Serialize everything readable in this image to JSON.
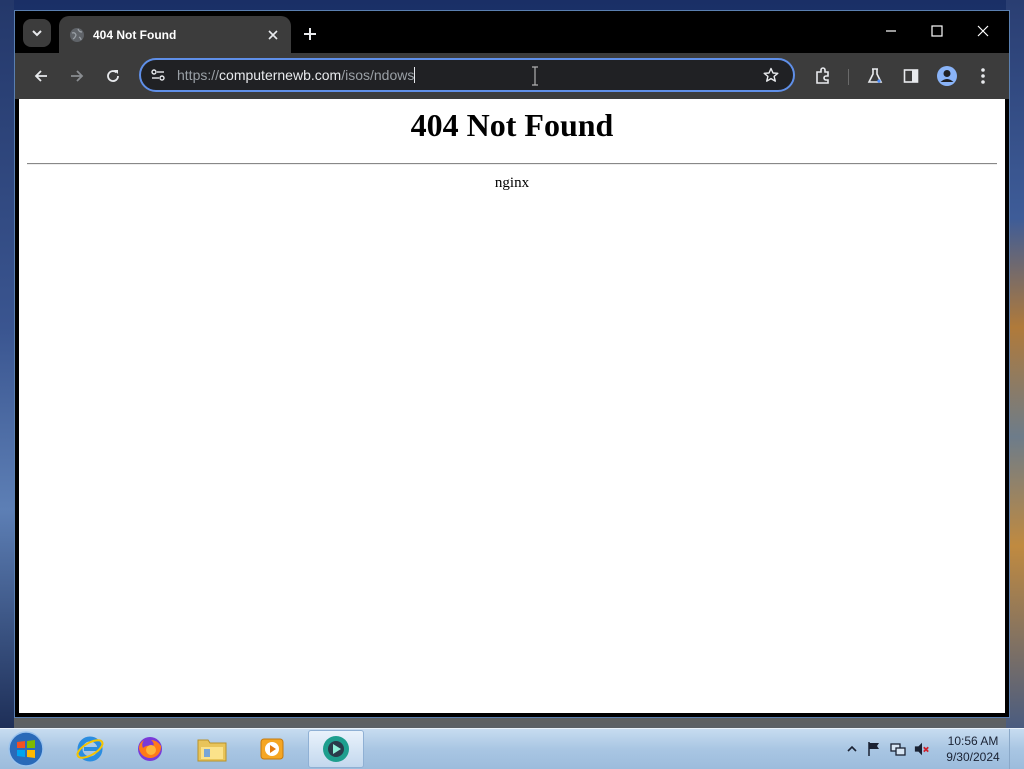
{
  "browser": {
    "tab": {
      "title": "404 Not Found"
    },
    "address_bar": {
      "url_scheme": "https://",
      "url_domain": "computernewb.com",
      "url_path": "/isos/ndows"
    }
  },
  "page": {
    "heading": "404 Not Found",
    "server": "nginx"
  },
  "taskbar": {
    "apps": [
      {
        "name": "Internet Explorer",
        "icon": "internet-explorer-icon"
      },
      {
        "name": "Firefox",
        "icon": "firefox-icon"
      },
      {
        "name": "File Explorer",
        "icon": "folder-icon"
      },
      {
        "name": "Media Player",
        "icon": "media-player-icon"
      },
      {
        "name": "Chrome-like browser",
        "icon": "browser-icon",
        "active": true
      }
    ],
    "clock": {
      "time": "10:56 AM",
      "date": "9/30/2024"
    }
  },
  "colors": {
    "omnibox_focus": "#5f8fe8",
    "toolbar_bg": "#3c3c3c",
    "titlebar_bg": "#000000"
  }
}
